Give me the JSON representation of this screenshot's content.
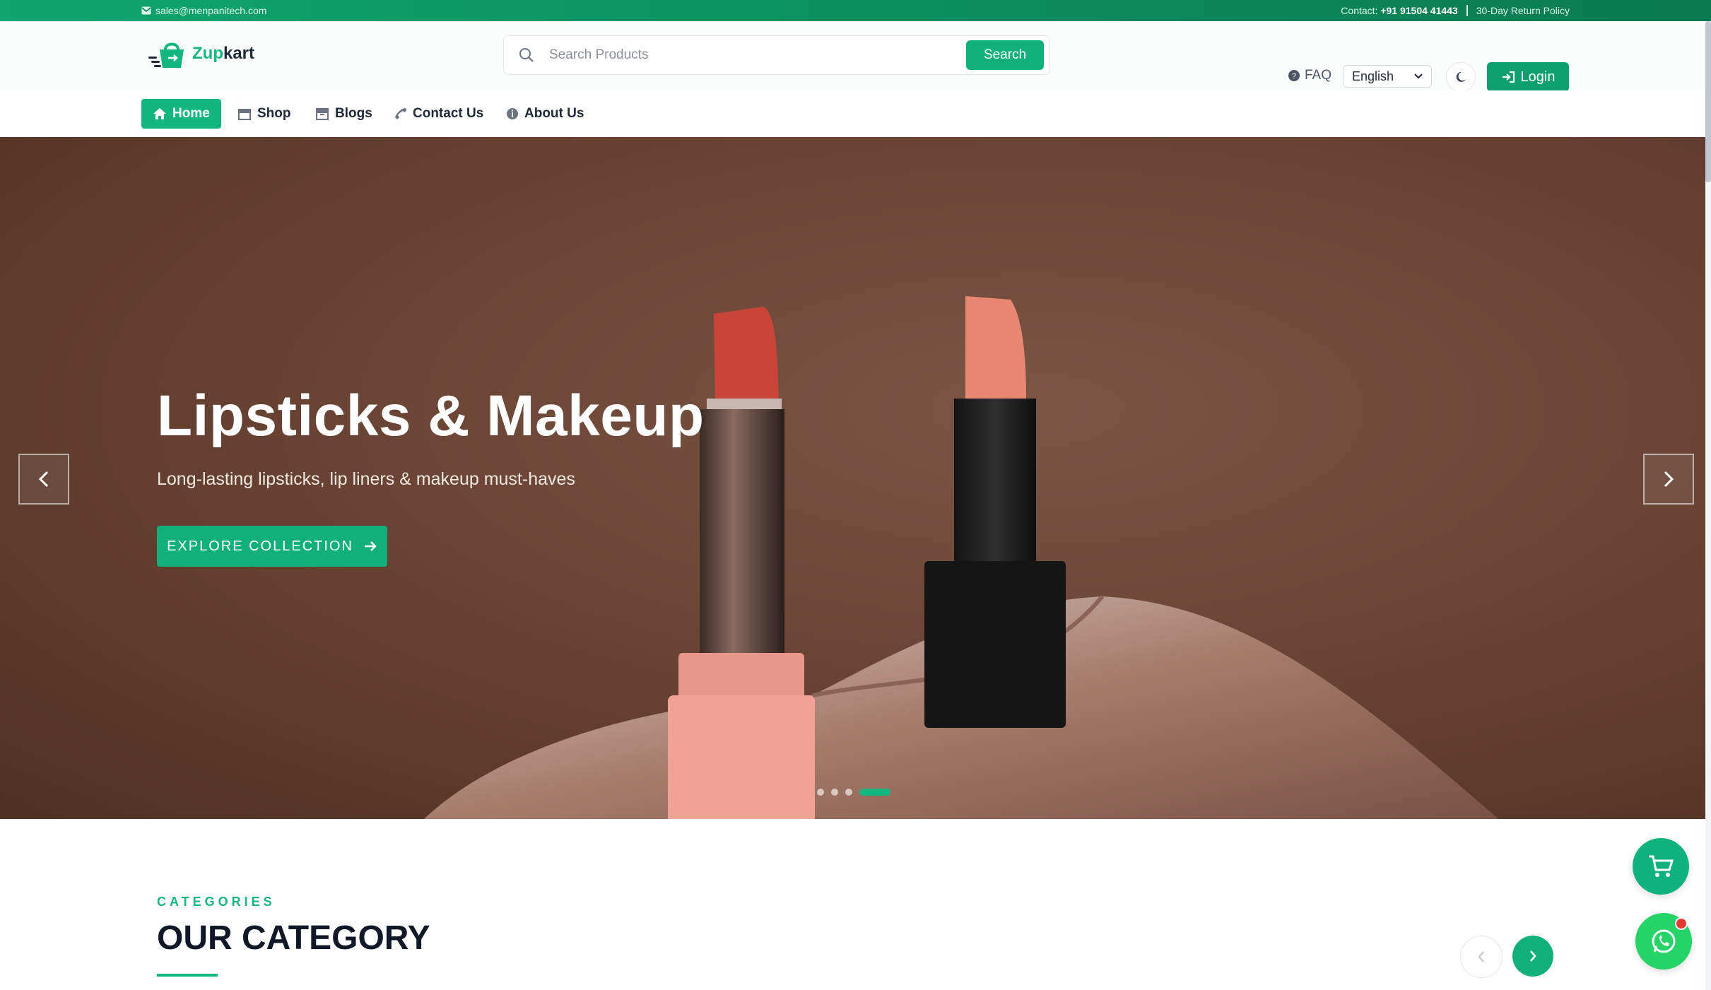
{
  "topbar": {
    "email": "sales@menpanitech.com",
    "contact_label": "Contact:",
    "contact_number": "+91 91504 41443",
    "return_policy": "30-Day Return Policy"
  },
  "header": {
    "brand_prefix": "Zup",
    "brand_suffix": "kart",
    "search_placeholder": "Search Products",
    "search_button": "Search",
    "faq": "FAQ",
    "language_selected": "English",
    "login": "Login"
  },
  "nav": {
    "items": [
      {
        "label": "Home",
        "icon": "home-icon"
      },
      {
        "label": "Shop",
        "icon": "store-icon"
      },
      {
        "label": "Blogs",
        "icon": "archive-icon"
      },
      {
        "label": "Contact Us",
        "icon": "phone-icon"
      },
      {
        "label": "About Us",
        "icon": "info-icon"
      }
    ]
  },
  "hero": {
    "title": "Lipsticks & Makeup",
    "subtitle": "Long-lasting lipsticks, lip liners & makeup must-haves",
    "cta": "EXPLORE COLLECTION",
    "active_slide": 4,
    "slide_count": 4
  },
  "categories": {
    "label": "CATEGORIES",
    "title": "OUR CATEGORY"
  },
  "colors": {
    "brand": "#12B67E",
    "topbar": "#0A7A52",
    "dark_text": "#111827",
    "whatsapp": "#26D366"
  }
}
